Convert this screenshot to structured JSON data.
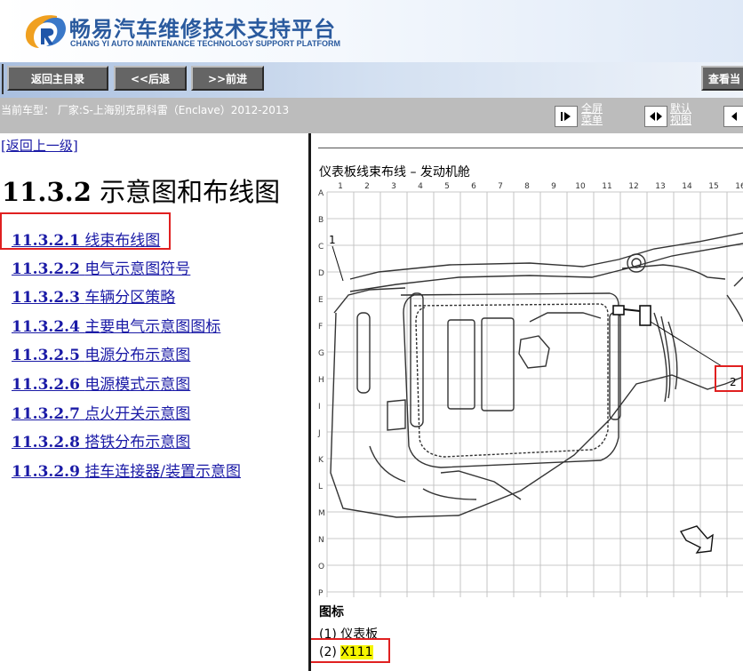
{
  "header": {
    "title_cn": "畅易汽车维修技术支持平台",
    "title_en": "CHANG YI AUTO MAINTENANCE TECHNOLOGY SUPPORT PLATFORM",
    "logo_icon": "cr-swirl-logo"
  },
  "toolbar": {
    "home_label": "返回主目录",
    "back_label": "<<后退",
    "forward_label": ">>前进",
    "view_label": "查看当"
  },
  "infobar": {
    "car_info": "当前车型： 厂家:S-上海别克昂科雷（Enclave）2012-2013",
    "fullscreen_line1": "全屏",
    "fullscreen_line2": "菜单",
    "default_line1": "默认",
    "default_line2": "视图"
  },
  "left": {
    "back_link": "[返回上一级]",
    "page_title_num": "11.3.2",
    "page_title_text": "示意图和布线图",
    "toc": [
      {
        "num": "11.3.2.1",
        "text": "线束布线图"
      },
      {
        "num": "11.3.2.2",
        "text": "电气示意图符号"
      },
      {
        "num": "11.3.2.3",
        "text": "车辆分区策略"
      },
      {
        "num": "11.3.2.4",
        "text": "主要电气示意图图标"
      },
      {
        "num": "11.3.2.5",
        "text": "电源分布示意图"
      },
      {
        "num": "11.3.2.6",
        "text": "电源模式示意图"
      },
      {
        "num": "11.3.2.7",
        "text": "点火开关示意图"
      },
      {
        "num": "11.3.2.8",
        "text": "搭铁分布示意图"
      },
      {
        "num": "11.3.2.9",
        "text": "挂车连接器/装置示意图"
      }
    ]
  },
  "diagram": {
    "title": "仪表板线束布线 – 发动机舱",
    "col_labels": [
      "1",
      "2",
      "3",
      "4",
      "5",
      "6",
      "7",
      "8",
      "9",
      "10",
      "11",
      "12",
      "13",
      "14",
      "15",
      "16"
    ],
    "row_labels": [
      "A",
      "B",
      "C",
      "D",
      "E",
      "F",
      "G",
      "H",
      "I",
      "J",
      "K",
      "L",
      "M",
      "N",
      "O",
      "P"
    ],
    "callout_1": "1",
    "callout_2": "2"
  },
  "legend": {
    "title": "图标",
    "item1_prefix": "(1) ",
    "item1_text": "仪表板",
    "item2_prefix": "(2) ",
    "item2_text": "X111"
  },
  "colors": {
    "link": "#1a1aa6",
    "highlight_box": "#e02020",
    "legend_highlight": "#f5f500",
    "brand_blue": "#2a5a9e",
    "toolbar_button": "#656565",
    "infobar": "#bcbcbc"
  }
}
